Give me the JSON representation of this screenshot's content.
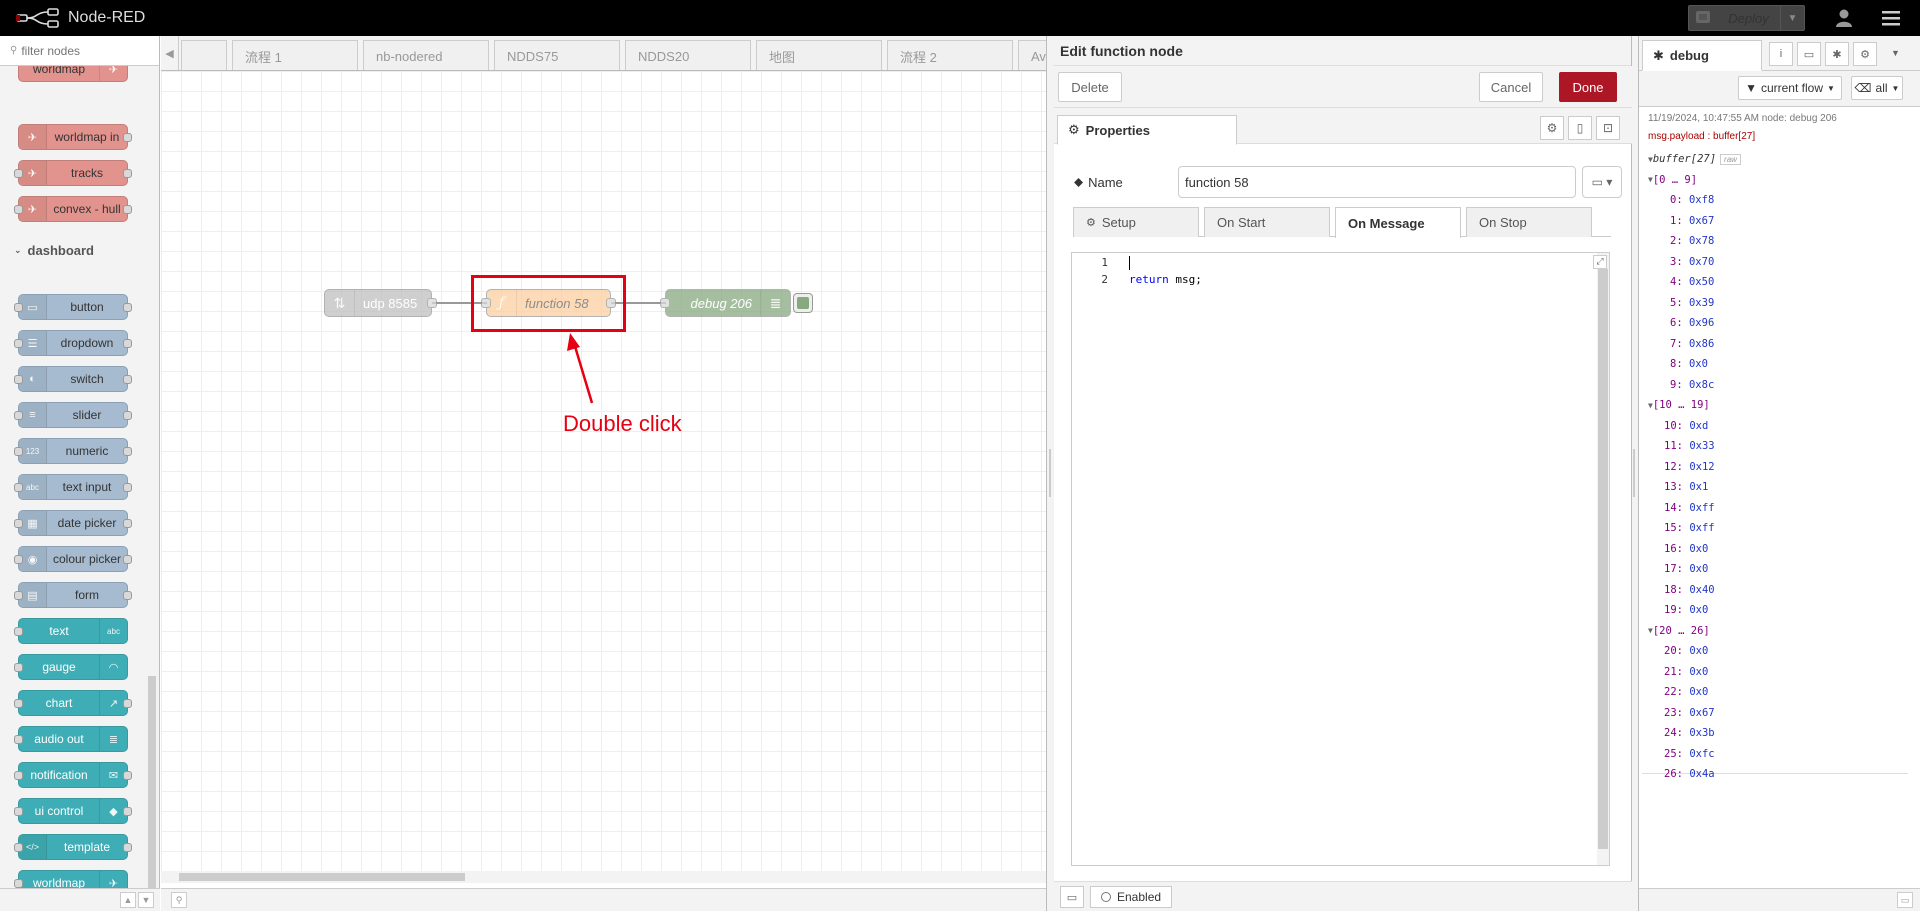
{
  "header": {
    "app_title": "Node-RED",
    "deploy_label": "Deploy"
  },
  "palette": {
    "filter_placeholder": "filter nodes",
    "map_nodes": [
      "worldmap",
      "worldmap in",
      "tracks",
      "convex - hull"
    ],
    "category": "dashboard",
    "dashboard_nodes": [
      "button",
      "dropdown",
      "switch",
      "slider",
      "numeric",
      "text input",
      "date picker",
      "colour picker",
      "form"
    ],
    "dashboard_nodes_teal": [
      "text",
      "gauge",
      "chart",
      "audio out",
      "notification",
      "ui control",
      "template",
      "worldmap"
    ]
  },
  "tabs": [
    "",
    "流程 1",
    "nb-nodered",
    "NDDS75",
    "NDDS20",
    "地图",
    "流程 2",
    "Av"
  ],
  "flow": {
    "nodes": {
      "udp": "udp 8585",
      "function": "function 58",
      "debug": "debug 206"
    },
    "annotation": "Double click"
  },
  "editor": {
    "title": "Edit function node",
    "delete_label": "Delete",
    "cancel_label": "Cancel",
    "done_label": "Done",
    "properties_tab": "Properties",
    "name_label": "Name",
    "name_value": "function 58",
    "code_tabs": [
      "Setup",
      "On Start",
      "On Message",
      "On Stop"
    ],
    "code_lines": [
      {
        "num": "1",
        "text": ""
      },
      {
        "num": "2",
        "keyword": "return",
        "rest": " msg;"
      }
    ],
    "enabled_label": "Enabled"
  },
  "sidebar": {
    "tab_label": "debug",
    "filter_flow": "current flow",
    "filter_all": "all",
    "message": {
      "meta": "11/19/2024, 10:47:55 AM    node: debug 206",
      "topic": "msg.payload : buffer[27]",
      "root": "buffer[27]",
      "raw": "raw",
      "groups": [
        {
          "label": "[0 … 9]",
          "items": [
            [
              "0",
              "0xf8"
            ],
            [
              "1",
              "0x67"
            ],
            [
              "2",
              "0x78"
            ],
            [
              "3",
              "0x70"
            ],
            [
              "4",
              "0x50"
            ],
            [
              "5",
              "0x39"
            ],
            [
              "6",
              "0x96"
            ],
            [
              "7",
              "0x86"
            ],
            [
              "8",
              "0x0"
            ],
            [
              "9",
              "0x8c"
            ]
          ]
        },
        {
          "label": "[10 … 19]",
          "items": [
            [
              "10",
              "0xd"
            ],
            [
              "11",
              "0x33"
            ],
            [
              "12",
              "0x12"
            ],
            [
              "13",
              "0x1"
            ],
            [
              "14",
              "0xff"
            ],
            [
              "15",
              "0xff"
            ],
            [
              "16",
              "0x0"
            ],
            [
              "17",
              "0x0"
            ],
            [
              "18",
              "0x40"
            ],
            [
              "19",
              "0x0"
            ]
          ]
        },
        {
          "label": "[20 … 26]",
          "items": [
            [
              "20",
              "0x0"
            ],
            [
              "21",
              "0x0"
            ],
            [
              "22",
              "0x0"
            ],
            [
              "23",
              "0x67"
            ],
            [
              "24",
              "0x3b"
            ],
            [
              "25",
              "0xfc"
            ],
            [
              "26",
              "0x4a"
            ]
          ]
        }
      ]
    }
  }
}
